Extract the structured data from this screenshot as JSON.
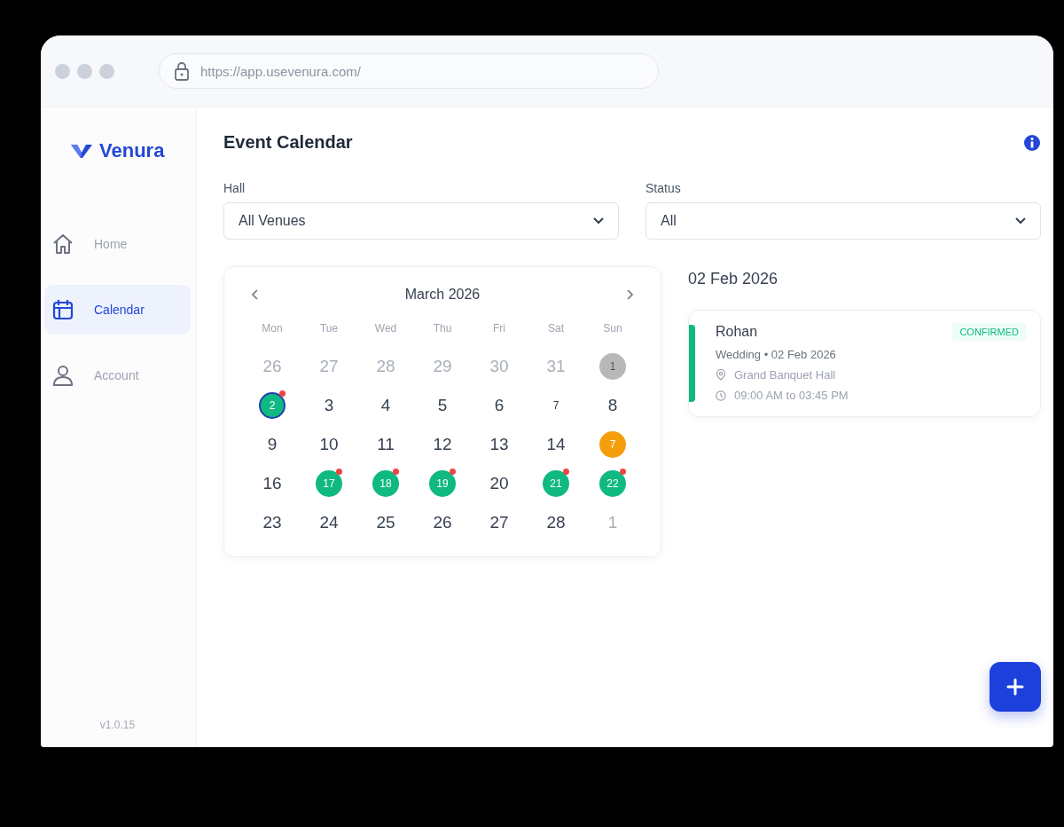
{
  "browser": {
    "url": "https://app.usevenura.com/"
  },
  "sidebar": {
    "brand": "Venura",
    "items": [
      {
        "label": "Home",
        "selected": false
      },
      {
        "label": "Calendar",
        "selected": true
      },
      {
        "label": "Account",
        "selected": false
      }
    ],
    "version": "v1.0.15"
  },
  "page": {
    "title": "Event Calendar"
  },
  "filters": [
    {
      "label": "Hall",
      "value": "All Venues"
    },
    {
      "label": "Status",
      "value": "All"
    }
  ],
  "calendar": {
    "month": "March 2026",
    "weekdays": [
      "Mon",
      "Tue",
      "Wed",
      "Thu",
      "Fri",
      "Sat",
      "Sun"
    ],
    "days": [
      {
        "text": "26",
        "kind": "other",
        "dot": false,
        "selected": false
      },
      {
        "text": "27",
        "kind": "other",
        "dot": false,
        "selected": false
      },
      {
        "text": "28",
        "kind": "other",
        "dot": false,
        "selected": false
      },
      {
        "text": "29",
        "kind": "other",
        "dot": false,
        "selected": false
      },
      {
        "text": "30",
        "kind": "other",
        "dot": false,
        "selected": false
      },
      {
        "text": "31",
        "kind": "other",
        "dot": false,
        "selected": false
      },
      {
        "text": "1",
        "kind": "past",
        "dot": false,
        "selected": false
      },
      {
        "text": "2",
        "kind": "booked",
        "dot": true,
        "selected": true
      },
      {
        "text": "3",
        "kind": "plain",
        "dot": false,
        "selected": false
      },
      {
        "text": "4",
        "kind": "plain",
        "dot": false,
        "selected": false
      },
      {
        "text": "5",
        "kind": "plain",
        "dot": false,
        "selected": false
      },
      {
        "text": "6",
        "kind": "plain",
        "dot": false,
        "selected": false
      },
      {
        "text": "7",
        "kind": "small",
        "dot": false,
        "selected": false
      },
      {
        "text": "8",
        "kind": "plain",
        "dot": false,
        "selected": false
      },
      {
        "text": "9",
        "kind": "plain",
        "dot": false,
        "selected": false
      },
      {
        "text": "10",
        "kind": "plain",
        "dot": false,
        "selected": false
      },
      {
        "text": "11",
        "kind": "plain",
        "dot": false,
        "selected": false
      },
      {
        "text": "12",
        "kind": "plain",
        "dot": false,
        "selected": false
      },
      {
        "text": "13",
        "kind": "plain",
        "dot": false,
        "selected": false
      },
      {
        "text": "14",
        "kind": "plain",
        "dot": false,
        "selected": false
      },
      {
        "text": "7",
        "kind": "pending",
        "dot": false,
        "selected": false
      },
      {
        "text": "16",
        "kind": "plain",
        "dot": false,
        "selected": false
      },
      {
        "text": "17",
        "kind": "booked",
        "dot": true,
        "selected": false
      },
      {
        "text": "18",
        "kind": "booked",
        "dot": true,
        "selected": false
      },
      {
        "text": "19",
        "kind": "booked",
        "dot": true,
        "selected": false
      },
      {
        "text": "20",
        "kind": "plain",
        "dot": false,
        "selected": false
      },
      {
        "text": "21",
        "kind": "booked",
        "dot": true,
        "selected": false
      },
      {
        "text": "22",
        "kind": "booked",
        "dot": true,
        "selected": false
      },
      {
        "text": "23",
        "kind": "plain",
        "dot": false,
        "selected": false
      },
      {
        "text": "24",
        "kind": "plain",
        "dot": false,
        "selected": false
      },
      {
        "text": "25",
        "kind": "plain",
        "dot": false,
        "selected": false
      },
      {
        "text": "26",
        "kind": "plain",
        "dot": false,
        "selected": false
      },
      {
        "text": "27",
        "kind": "plain",
        "dot": false,
        "selected": false
      },
      {
        "text": "28",
        "kind": "plain",
        "dot": false,
        "selected": false
      },
      {
        "text": "1",
        "kind": "other",
        "dot": false,
        "selected": false
      }
    ]
  },
  "day_panel": {
    "date": "02 Feb 2026",
    "events": [
      {
        "name": "Rohan",
        "status": "CONFIRMED",
        "color": "#10b981",
        "details": "Wedding • 02 Feb 2026",
        "venue": "Grand Banquet Hall",
        "time": "09:00 AM to 03:45 PM"
      }
    ]
  }
}
